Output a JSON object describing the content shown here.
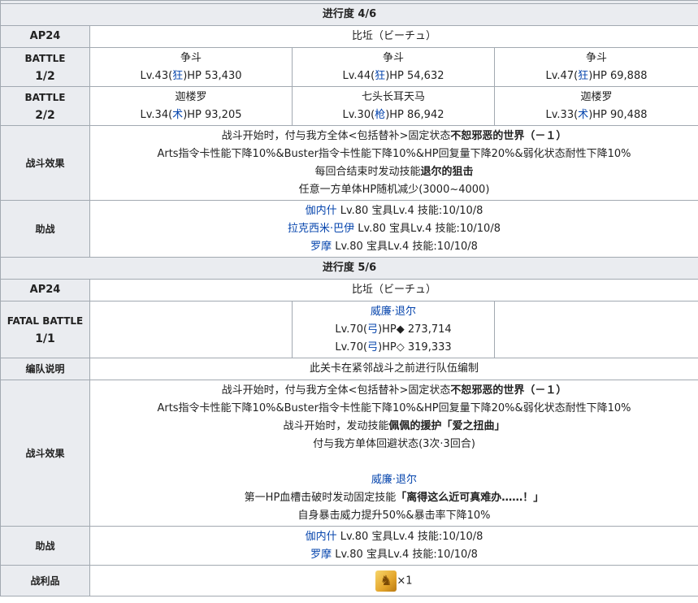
{
  "sec1": {
    "title": "进行度 4/6",
    "ap_label": "AP24",
    "ap_value": "比坵（ビーチュ）",
    "battle1_label_top": "BATTLE",
    "battle1_label_bottom": "1/2",
    "battle1": [
      {
        "name": "争斗",
        "lv": "Lv.43(",
        "cls": "狂",
        "hp": ")HP 53,430"
      },
      {
        "name": "争斗",
        "lv": "Lv.44(",
        "cls": "狂",
        "hp": ")HP 54,632"
      },
      {
        "name": "争斗",
        "lv": "Lv.47(",
        "cls": "狂",
        "hp": ")HP 69,888"
      }
    ],
    "battle2_label_top": "BATTLE",
    "battle2_label_bottom": "2/2",
    "battle2": [
      {
        "name": "迦楼罗",
        "lv": "Lv.34(",
        "cls": "术",
        "hp": ")HP 93,205"
      },
      {
        "name": "七头长耳天马",
        "lv": "Lv.30(",
        "cls": "枪",
        "hp": ")HP 86,942"
      },
      {
        "name": "迦楼罗",
        "lv": "Lv.33(",
        "cls": "术",
        "hp": ")HP 90,488"
      }
    ],
    "effect_label": "战斗效果",
    "effect": {
      "l1a": "战斗开始时，付与我方全体<包括替补>固定状态",
      "l1b": "不恕邪恶的世界（－１）",
      "l2": "Arts指令卡性能下降10%&Buster指令卡性能下降10%&HP回复量下降20%&弱化状态耐性下降10%",
      "l3a": "每回合结束时发动技能",
      "l3b": "退尔的狙击",
      "l4": "任意一方单体HP随机减少(3000~4000)"
    },
    "support_label": "助战",
    "support": [
      {
        "name": "伽内什",
        "rest": " Lv.80 宝具Lv.4 技能:10/10/8"
      },
      {
        "name": "拉克西米·巴伊",
        "rest": " Lv.80 宝具Lv.4 技能:10/10/8"
      },
      {
        "name": "罗摩",
        "rest": " Lv.80 宝具Lv.4 技能:10/10/8"
      }
    ]
  },
  "sec2": {
    "title": "进行度 5/6",
    "ap_label": "AP24",
    "ap_value": "比坵（ビーチュ）",
    "fatal_label_top": "FATAL BATTLE",
    "fatal_label_bottom": "1/1",
    "boss_name": "威廉·退尔",
    "boss_lines": [
      {
        "lv": "Lv.70(",
        "cls": "弓",
        "hp": ")HP◆ 273,714"
      },
      {
        "lv": "Lv.70(",
        "cls": "弓",
        "hp": ")HP◇ 319,333"
      }
    ],
    "formation_label": "编队说明",
    "formation_text": "此关卡在紧邻战斗之前进行队伍编制",
    "effect_label": "战斗效果",
    "effect": {
      "l1a": "战斗开始时，付与我方全体<包括替补>固定状态",
      "l1b": "不恕邪恶的世界（－１）",
      "l2": "Arts指令卡性能下降10%&Buster指令卡性能下降10%&HP回复量下降20%&弱化状态耐性下降10%",
      "l3a": "战斗开始时，发动技能",
      "l3b": "佩佩的援护「爱之扭曲」",
      "l4": "付与我方单体回避状态(3次·3回合)",
      "l5": "威廉·退尔",
      "l6a": "第一HP血槽击破时发动固定技能",
      "l6b": "「离得这么近可真难办……！」",
      "l7": "自身暴击威力提升50%&暴击率下降10%"
    },
    "support_label": "助战",
    "support": [
      {
        "name": "伽内什",
        "rest": " Lv.80 宝具Lv.4 技能:10/10/8"
      },
      {
        "name": "罗摩",
        "rest": " Lv.80 宝具Lv.4 技能:10/10/8"
      }
    ],
    "loot_label": "战利品",
    "loot_icon": "gold-item-icon",
    "loot_count": "×1"
  }
}
